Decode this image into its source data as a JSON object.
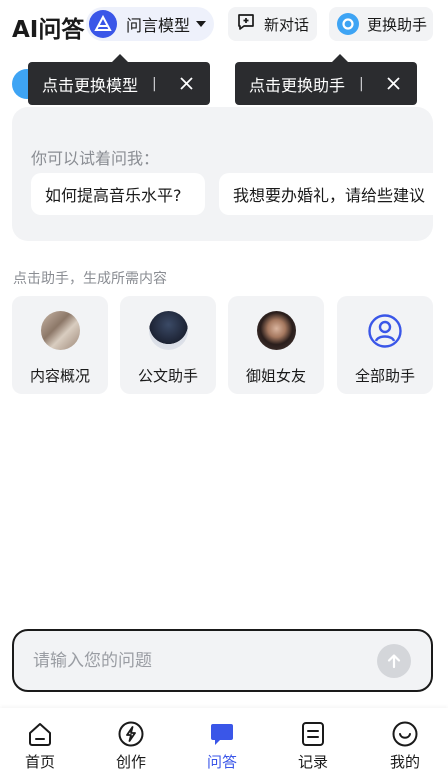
{
  "header": {
    "app_title": "AI问答",
    "model_label": "问言模型",
    "new_chat_label": "新对话",
    "switch_assistant_label": "更换助手"
  },
  "tooltips": {
    "model_tip": "点击更换模型",
    "assistant_tip": "点击更换助手",
    "separator": "|"
  },
  "suggestions": {
    "title": "你可以试着问我：",
    "items": [
      "如何提高音乐水平?",
      "我想要办婚礼，请给些建议"
    ]
  },
  "assistants": {
    "section_label": "点击助手，生成所需内容",
    "items": [
      {
        "name": "内容概况",
        "icon": "content-avatar"
      },
      {
        "name": "公文助手",
        "icon": "document-avatar"
      },
      {
        "name": "御姐女友",
        "icon": "girlfriend-avatar"
      },
      {
        "name": "全部助手",
        "icon": "user-circle-icon"
      }
    ]
  },
  "input": {
    "placeholder": "请输入您的问题",
    "value": ""
  },
  "bottom_nav": {
    "items": [
      {
        "label": "首页",
        "icon": "home-icon",
        "active": false
      },
      {
        "label": "创作",
        "icon": "lightning-icon",
        "active": false
      },
      {
        "label": "问答",
        "icon": "chat-bubble-icon",
        "active": true
      },
      {
        "label": "记录",
        "icon": "list-icon",
        "active": false
      },
      {
        "label": "我的",
        "icon": "smile-icon",
        "active": false
      }
    ]
  },
  "colors": {
    "accent": "#3a56e8",
    "assistant_blue": "#3ea4f4",
    "card_bg": "#f2f3f5",
    "tooltip_bg": "#2b2c2f"
  }
}
